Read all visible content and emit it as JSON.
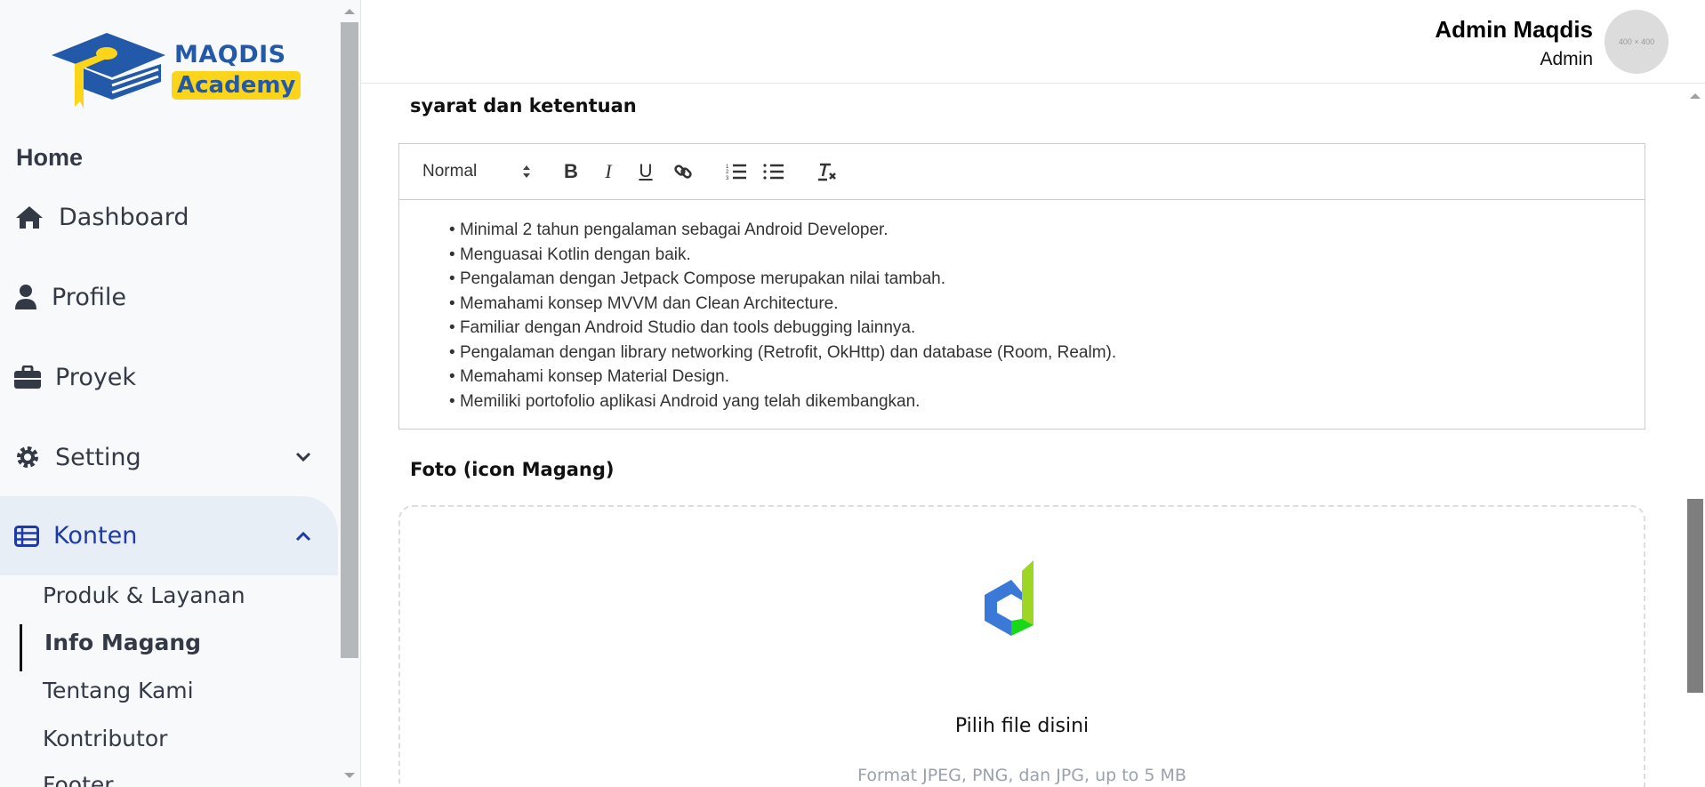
{
  "brand": {
    "line1": "MAQDIS",
    "line2": "Academy",
    "colors": {
      "blue": "#2259a8",
      "yellow": "#fcd419"
    }
  },
  "sidebar": {
    "section_title": "Home",
    "items": [
      {
        "label": "Dashboard",
        "icon": "home-icon"
      },
      {
        "label": "Profile",
        "icon": "user-icon"
      },
      {
        "label": "Proyek",
        "icon": "briefcase-icon"
      },
      {
        "label": "Setting",
        "icon": "gear-icon"
      },
      {
        "label": "Konten",
        "icon": "table-list-icon"
      }
    ],
    "sub_items": [
      {
        "label": "Produk & Layanan"
      },
      {
        "label": "Info Magang",
        "active": true
      },
      {
        "label": "Tentang Kami"
      },
      {
        "label": "Kontributor"
      },
      {
        "label": "Footer"
      }
    ],
    "active_color": "#1e3aa8"
  },
  "header": {
    "user_name": "Admin Maqdis",
    "user_role": "Admin",
    "avatar_placeholder": "400 × 400"
  },
  "form": {
    "terms_label": "syarat dan ketentuan",
    "editor": {
      "format_select": "Normal",
      "bullets": [
        "Minimal 2 tahun pengalaman sebagai Android Developer.",
        "Menguasai Kotlin dengan baik.",
        "Pengalaman dengan Jetpack Compose merupakan nilai tambah.",
        "Memahami konsep MVVM dan Clean Architecture.",
        "Familiar dengan Android Studio dan tools debugging lainnya.",
        "Pengalaman dengan library networking (Retrofit, OkHttp) dan database (Room, Realm).",
        "Memahami konsep Material Design.",
        "Memiliki portofolio aplikasi Android yang telah dikembangkan."
      ]
    },
    "photo_label": "Foto (icon Magang)",
    "upload": {
      "title": "Pilih file disini",
      "hint": "Format JPEG, PNG, dan JPG, up to 5 MB"
    }
  }
}
